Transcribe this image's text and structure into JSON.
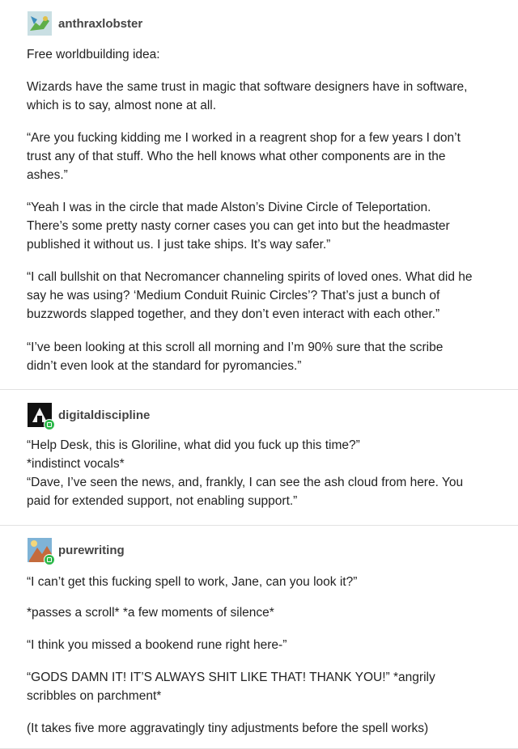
{
  "posts": [
    {
      "username": "anthraxlobster",
      "paragraphs": [
        "Free worldbuilding idea:",
        "Wizards have the same trust in magic that software designers have in software,\nwhich is to say, almost none at all.",
        "“Are you fucking kidding me I worked in a reagrent shop for a few years I don’t\ntrust any of that stuff. Who the hell knows what other components are in the\nashes.”",
        "“Yeah I was in the circle that made Alston’s Divine Circle of Teleportation.\nThere’s some pretty nasty corner cases you can get into but the headmaster\npublished it without us. I just take ships. It’s way safer.”",
        "“I call bullshit on that Necromancer channeling spirits of loved ones. What did he\nsay he was using? ‘Medium Conduit Ruinic Circles’? That’s just a bunch of\nbuzzwords slapped together, and they don’t even interact with each other.”",
        "“I’ve been looking at this scroll all morning and I’m 90% sure that the scribe\ndidn’t even look at the standard for pyromancies.”"
      ]
    },
    {
      "username": "digitaldiscipline",
      "paragraphs": [
        "“Help Desk, this is Gloriline, what did you fuck up this time?”\n*indistinct vocals*\n“Dave, I’ve seen the news, and, frankly, I can see the ash cloud from here. You\npaid for extended support, not enabling support.”"
      ]
    },
    {
      "username": "purewriting",
      "paragraphs": [
        "“I can’t get this fucking spell to work, Jane, can you look it?”",
        "*passes a scroll* *a few moments of silence*",
        "“I think you missed a bookend rune right here-”",
        "“GODS DAMN IT! IT’S ALWAYS SHIT LIKE THAT! THANK YOU!” *angrily\nscribbles on parchment*",
        "(It takes five more aggravatingly tiny adjustments before the spell works)"
      ]
    }
  ]
}
